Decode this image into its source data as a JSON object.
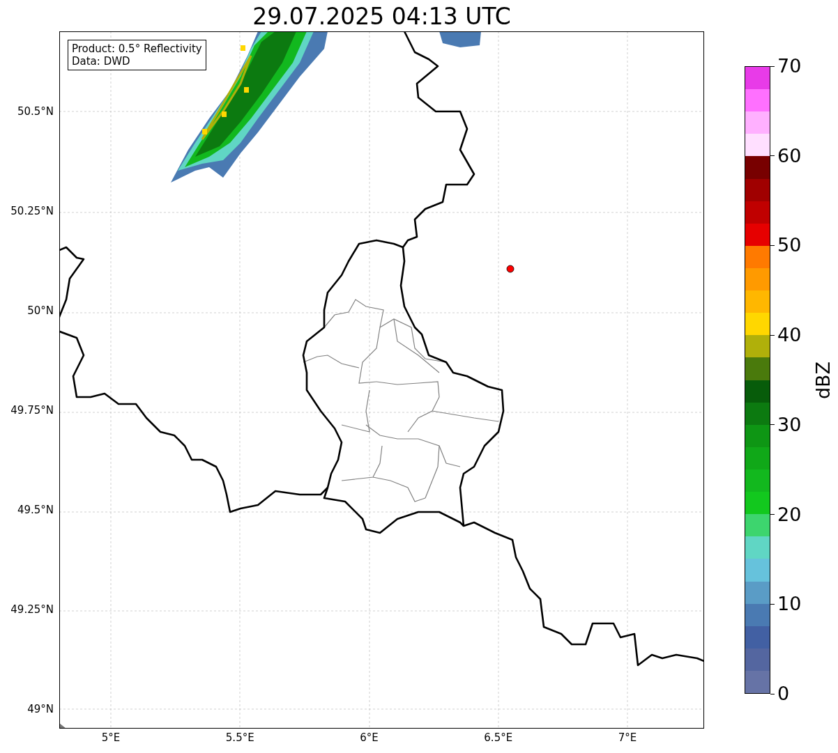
{
  "title": "29.07.2025 04:13 UTC",
  "info_box": [
    "Product: 0.5° Reflectivity",
    "Data: DWD"
  ],
  "map": {
    "lat_ticks": [
      "50.5°N",
      "50.25°N",
      "50°N",
      "49.75°N",
      "49.5°N",
      "49.25°N",
      "49°N"
    ],
    "lon_ticks": [
      "5°E",
      "5.5°E",
      "6°E",
      "6.5°E",
      "7°E"
    ]
  },
  "colorbar": {
    "label": "dBZ",
    "ticks": [
      "70",
      "60",
      "50",
      "40",
      "30",
      "20",
      "10",
      "0"
    ],
    "bins": [
      {
        "color": "#e83be8"
      },
      {
        "color": "#ff70ff"
      },
      {
        "color": "#ffb0ff"
      },
      {
        "color": "#ffdfff"
      },
      {
        "color": "#780000"
      },
      {
        "color": "#a00000"
      },
      {
        "color": "#c00000"
      },
      {
        "color": "#e60000"
      },
      {
        "color": "#ff7a00"
      },
      {
        "color": "#ff9a00"
      },
      {
        "color": "#ffb700"
      },
      {
        "color": "#ffd700"
      },
      {
        "color": "#b0b00a"
      },
      {
        "color": "#4a7a0c"
      },
      {
        "color": "#075c0a"
      },
      {
        "color": "#0c7a10"
      },
      {
        "color": "#0e9614"
      },
      {
        "color": "#10a818"
      },
      {
        "color": "#12b81e"
      },
      {
        "color": "#12c81e"
      },
      {
        "color": "#3dd56e"
      },
      {
        "color": "#60d6c4"
      },
      {
        "color": "#66c2dc"
      },
      {
        "color": "#5a9cc6"
      },
      {
        "color": "#4a7ab2"
      },
      {
        "color": "#4260a3"
      },
      {
        "color": "#5466a0"
      },
      {
        "color": "#6673a6"
      }
    ]
  }
}
